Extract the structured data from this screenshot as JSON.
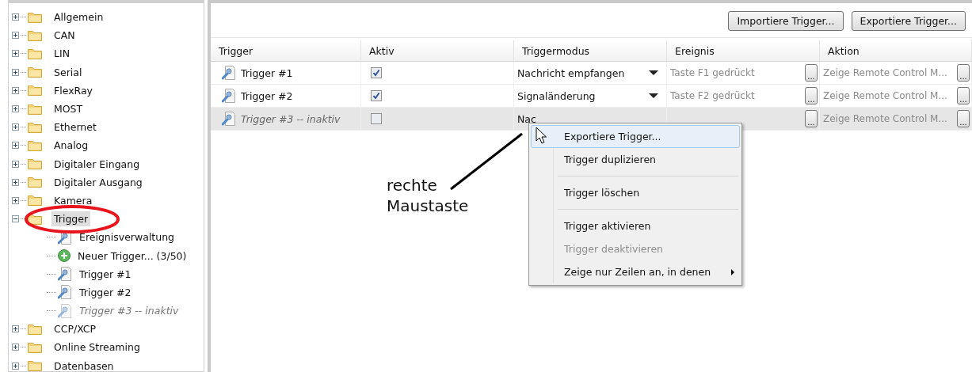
{
  "tree": [
    {
      "label": "Allgemein",
      "expanded": false,
      "selected": false
    },
    {
      "label": "CAN",
      "expanded": false,
      "selected": false
    },
    {
      "label": "LIN",
      "expanded": false,
      "selected": false
    },
    {
      "label": "Serial",
      "expanded": false,
      "selected": false
    },
    {
      "label": "FlexRay",
      "expanded": false,
      "selected": false
    },
    {
      "label": "MOST",
      "expanded": false,
      "selected": false
    },
    {
      "label": "Ethernet",
      "expanded": false,
      "selected": false
    },
    {
      "label": "Analog",
      "expanded": false,
      "selected": false
    },
    {
      "label": "Digitaler Eingang",
      "expanded": false,
      "selected": false
    },
    {
      "label": "Digitaler Ausgang",
      "expanded": false,
      "selected": false
    },
    {
      "label": "Kamera",
      "expanded": false,
      "selected": false
    },
    {
      "label": "Trigger",
      "expanded": true,
      "selected": true,
      "children": [
        {
          "kind": "manager",
          "label": "Ereignisverwaltung",
          "active": true
        },
        {
          "kind": "new",
          "label": "Neuer Trigger... (3/50)",
          "active": true
        },
        {
          "kind": "trigger",
          "label": "Trigger #1",
          "active": true
        },
        {
          "kind": "trigger",
          "label": "Trigger #2",
          "active": true
        },
        {
          "kind": "trigger",
          "label": "Trigger #3 -- inaktiv",
          "active": false
        }
      ]
    },
    {
      "label": "CCP/XCP",
      "expanded": false,
      "selected": false
    },
    {
      "label": "Online Streaming",
      "expanded": false,
      "selected": false
    },
    {
      "label": "Datenbasen",
      "expanded": false,
      "selected": false
    }
  ],
  "toolbar": {
    "buttons": [
      "Importiere Trigger...",
      "Exportiere Trigger..."
    ]
  },
  "table": {
    "columns": [
      "Trigger",
      "Aktiv",
      "Triggermodus",
      "Ereignis",
      "Aktion"
    ],
    "rows": [
      {
        "name": "Trigger #1",
        "active": true,
        "mode": "Nachricht empfangen",
        "event": "Taste F1 gedrückt",
        "event_button": "...",
        "action": "Zeige Remote Control M...",
        "action_button": "..."
      },
      {
        "name": "Trigger #2",
        "active": true,
        "mode": "Signaländerung",
        "event": "Taste F2 gedrückt",
        "event_button": "...",
        "action": "Zeige Remote Control M...",
        "action_button": "..."
      },
      {
        "name": "Trigger #3 -- inaktiv",
        "active": false,
        "mode": "Nac",
        "event_button": "...",
        "action": "Zeige Remote Control M...",
        "action_button": "..."
      }
    ]
  },
  "context_menu": {
    "items": [
      {
        "kind": "item",
        "label": "Exportiere Trigger...",
        "selected": true,
        "disabled": false,
        "submenu": false
      },
      {
        "kind": "item",
        "label": "Trigger duplizieren",
        "selected": false,
        "disabled": false,
        "submenu": false
      },
      {
        "kind": "separator"
      },
      {
        "kind": "item",
        "label": "Trigger löschen",
        "selected": false,
        "disabled": false,
        "submenu": false
      },
      {
        "kind": "separator"
      },
      {
        "kind": "item",
        "label": "Trigger aktivieren",
        "selected": false,
        "disabled": false,
        "submenu": false
      },
      {
        "kind": "item",
        "label": "Trigger deaktivieren",
        "selected": false,
        "disabled": true,
        "submenu": false
      },
      {
        "kind": "item",
        "label": "Zeige nur Zeilen an, in denen",
        "selected": false,
        "disabled": false,
        "submenu": true
      }
    ]
  },
  "annotation": {
    "text": "rechte Maustaste"
  }
}
